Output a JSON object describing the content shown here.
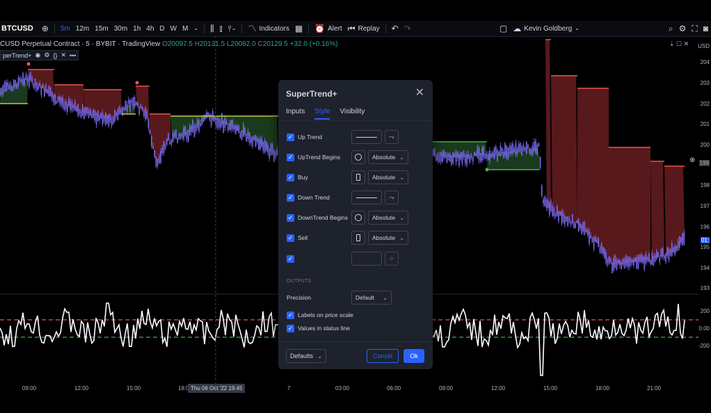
{
  "toolbar": {
    "symbol": "BTCUSD",
    "intervals": [
      "5m",
      "12m",
      "15m",
      "30m",
      "1h",
      "4h",
      "D",
      "W",
      "M"
    ],
    "active_interval": "5m",
    "indicators_label": "Indicators",
    "alert_label": "Alert",
    "replay_label": "Replay",
    "user_name": "Kevin Goldberg"
  },
  "legend": {
    "title": "CUSD Perpetual Contract · 5 · BYBIT · TradingView",
    "o_label": "O",
    "o": "20097.5",
    "h_label": "H",
    "h": "20131.5",
    "l_label": "L",
    "l": "20082.0",
    "c_label": "C",
    "c": "20129.5",
    "change": "+32.0 (+0.16%)",
    "indicator_label": "perTrend+"
  },
  "price_scale": {
    "currency": "USD",
    "labels": [
      "204",
      "203",
      "202",
      "201",
      "200",
      "199",
      "198",
      "197",
      "196",
      "195",
      "194",
      "193",
      "200",
      "0.00",
      "-200"
    ],
    "current": "199",
    "marker": "01:"
  },
  "time_axis": {
    "labels": [
      "09:00",
      "12:00",
      "15:00",
      "18:0",
      "7",
      "03:00",
      "06:00",
      "09:00",
      "12:00",
      "15:00",
      "18:00",
      "21:00"
    ],
    "crosshair": "Thu 06 Oct '22   19:45"
  },
  "dialog": {
    "title": "SuperTrend+",
    "tabs": [
      {
        "label": "Inputs",
        "active": false
      },
      {
        "label": "Style",
        "active": true
      },
      {
        "label": "Visibility",
        "active": false
      }
    ],
    "rows": [
      {
        "label": "Up Trend",
        "control": "line"
      },
      {
        "label": "UpTrend Begins",
        "control": "circle",
        "select": "Absolute"
      },
      {
        "label": "Buy",
        "control": "rect",
        "select": "Absolute"
      },
      {
        "label": "Down Trend",
        "control": "line"
      },
      {
        "label": "DownTrend Begins",
        "control": "circle",
        "select": "Absolute"
      },
      {
        "label": "Sell",
        "control": "rect",
        "select": "Absolute"
      },
      {
        "label": "",
        "control": "empty"
      }
    ],
    "outputs_header": "OUTPUTS",
    "precision_label": "Precision",
    "precision_value": "Default",
    "check_labels_on_price_scale": "Labels on price scale",
    "check_values_in_status_line": "Values in status line",
    "defaults_label": "Defaults",
    "cancel_label": "Cancel",
    "ok_label": "Ok"
  },
  "colors": {
    "accent": "#2962ff",
    "up_trend": "#4caf50",
    "down_trend": "#ef5350",
    "down_fill": "#5d1a1d",
    "up_fill": "#1b3d1f",
    "candle": "#7b6cf6",
    "dialog_bg": "#1e222d"
  }
}
